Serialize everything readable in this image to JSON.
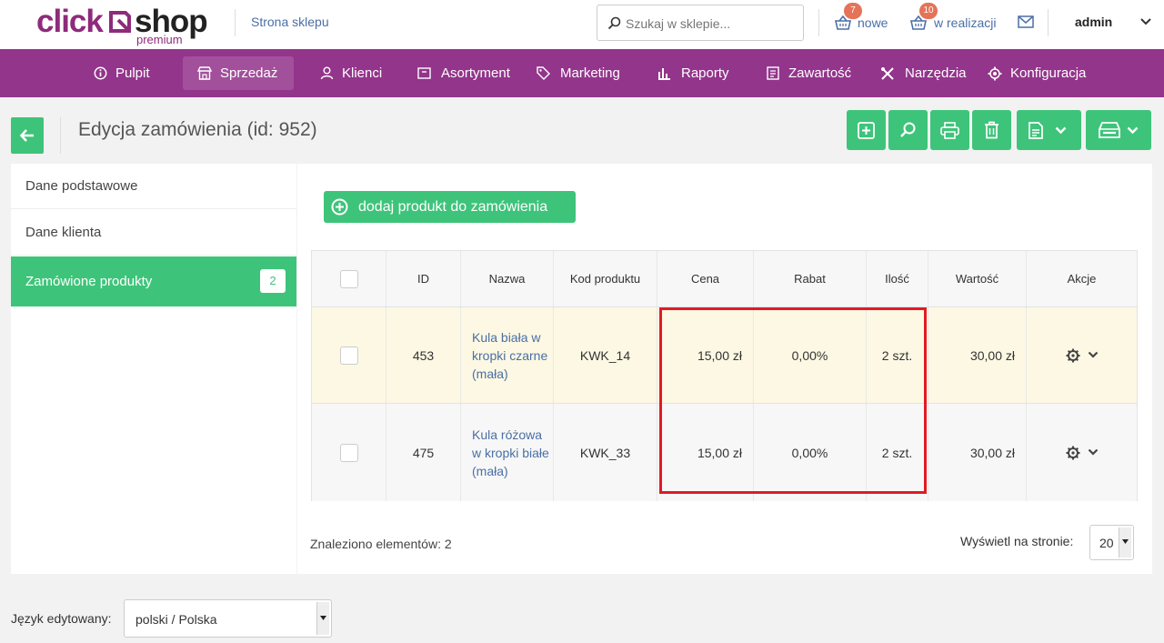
{
  "brand": {
    "left": "click",
    "right": "shop",
    "tier": "premium"
  },
  "header": {
    "store_link": "Strona sklepu",
    "search_placeholder": "Szukaj w sklepie...",
    "orders_new": {
      "label": "nowe",
      "count": "7"
    },
    "orders_in_progress": {
      "label": "w realizacji",
      "count": "10"
    },
    "user": "admin"
  },
  "nav": [
    {
      "label": "Pulpit",
      "icon": "info-circle-icon"
    },
    {
      "label": "Sprzedaż",
      "icon": "shop-icon",
      "active": true
    },
    {
      "label": "Klienci",
      "icon": "user-icon"
    },
    {
      "label": "Asortyment",
      "icon": "box-icon"
    },
    {
      "label": "Marketing",
      "icon": "tag-icon"
    },
    {
      "label": "Raporty",
      "icon": "bar-chart-icon"
    },
    {
      "label": "Zawartość",
      "icon": "document-icon"
    },
    {
      "label": "Narzędzia",
      "icon": "tools-icon"
    },
    {
      "label": "Konfiguracja",
      "icon": "gear-icon"
    }
  ],
  "page": {
    "title": "Edycja zamówienia (id: 952)",
    "toolbar": [
      "add-icon",
      "search-icon",
      "print-icon",
      "trash-icon",
      "document-icon",
      "printer-tray-icon"
    ]
  },
  "sidebar": {
    "items": [
      {
        "label": "Dane podstawowe"
      },
      {
        "label": "Dane klienta"
      },
      {
        "label": "Zamówione produkty",
        "count": "2",
        "active": true
      }
    ]
  },
  "main": {
    "add_product_label": "dodaj produkt do zamówienia",
    "table": {
      "columns": [
        "",
        "ID",
        "Nazwa",
        "Kod produktu",
        "Cena",
        "Rabat",
        "Ilość",
        "Wartość",
        "Akcje"
      ],
      "rows": [
        {
          "id": "453",
          "name": "Kula biała w kropki czarne (mała)",
          "code": "KWK_14",
          "price": "15,00 zł",
          "discount": "0,00%",
          "qty": "2 szt.",
          "value": "30,00 zł"
        },
        {
          "id": "475",
          "name": "Kula różowa w kropki białe (mała)",
          "code": "KWK_33",
          "price": "15,00 zł",
          "discount": "0,00%",
          "qty": "2 szt.",
          "value": "30,00 zł"
        }
      ]
    },
    "found_label": "Znaleziono elementów: 2",
    "per_page_label": "Wyświetl na stronie:",
    "per_page_value": "20"
  },
  "language": {
    "label": "Język edytowany:",
    "value": "polski / Polska"
  },
  "colors": {
    "purple": "#93358b",
    "green": "#3ec47a",
    "highlight": "#e01b24",
    "link": "#4a6fa5"
  }
}
